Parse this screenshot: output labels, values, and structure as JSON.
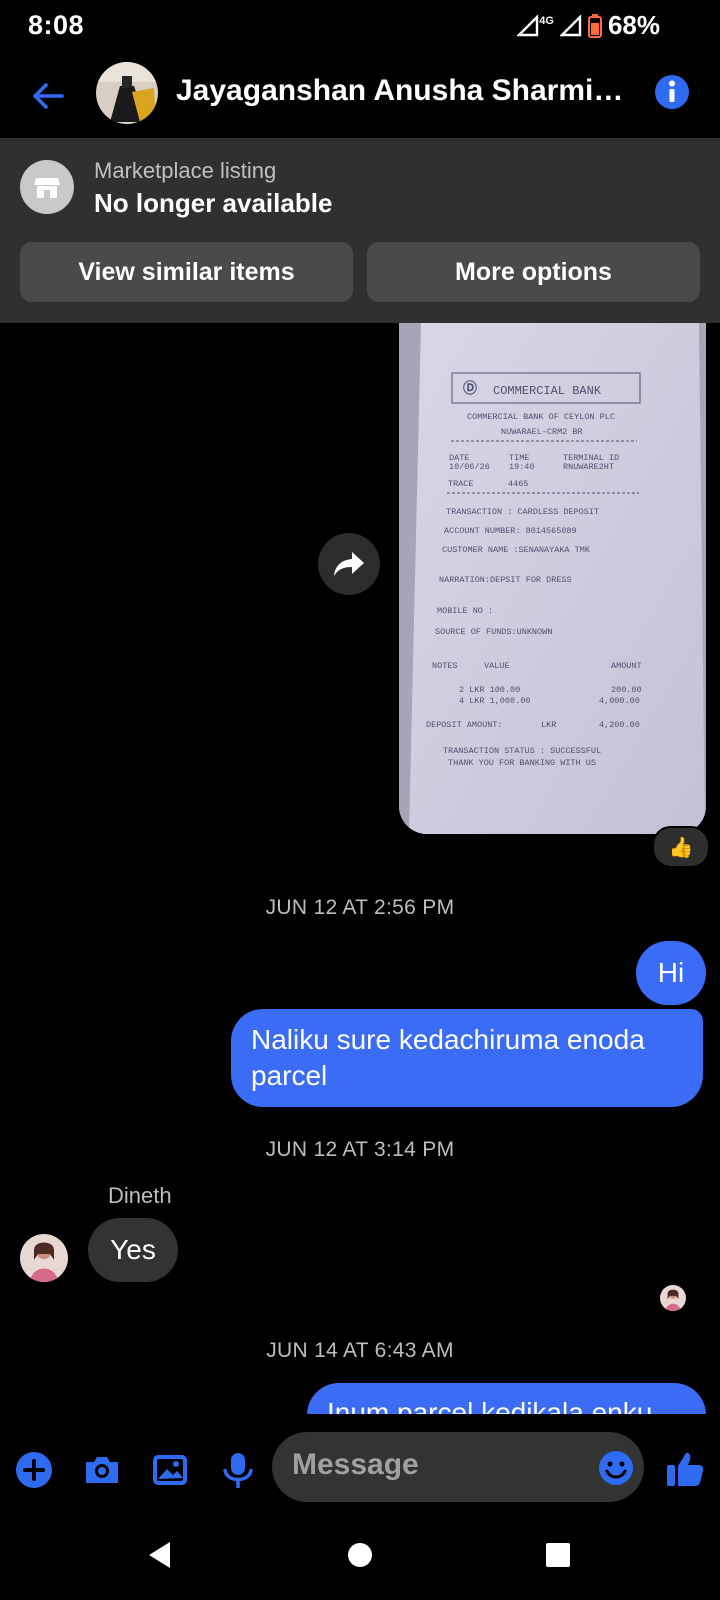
{
  "status_bar": {
    "time": "8:08",
    "network": "4G",
    "battery": "68%"
  },
  "header": {
    "contact_name": "Jayaganshan Anusha Sharmila…",
    "back_icon": "arrow-left-icon",
    "info_icon": "info-icon"
  },
  "marketplace": {
    "label": "Marketplace listing",
    "status": "No longer available",
    "btn_similar": "View similar items",
    "btn_more": "More options",
    "icon": "storefront-icon"
  },
  "receipt": {
    "bank": "COMMERCIAL BANK",
    "bank_full": "COMMERCIAL BANK OF CEYLON PLC",
    "branch": "NUWARAEL-CRM2 BR",
    "date_label": "DATE",
    "date": "10/06/26",
    "time_label": "TIME",
    "time": "19:40",
    "terminal_label": "TERMINAL ID",
    "terminal": "RNUWARE2HT",
    "trace_label": "TRACE",
    "trace": "4465",
    "transaction": "TRANSACTION   : CARDLESS DEPOSIT",
    "account": "ACCOUNT NUMBER: 8014565089",
    "customer": "CUSTOMER NAME :SENANAYAKA TMK",
    "narration": "NARRATION:DEPSIT FOR DRESS",
    "mobile": "MOBILE NO :",
    "source": "SOURCE OF FUNDS:UNKNOWN",
    "notes_header": "NOTES",
    "value_header": "VALUE",
    "amount_header": "AMOUNT",
    "row1": "2   LKR   100.00",
    "row1_amt": "200.00",
    "row2": "4   LKR 1,000.00",
    "row2_amt": "4,000.00",
    "deposit_label": "DEPOSIT AMOUNT:",
    "deposit_cur": "LKR",
    "deposit_amt": "4,200.00",
    "status_line": "TRANSACTION STATUS : SUCCESSFUL",
    "thanks": "THANK YOU FOR BANKING WITH US"
  },
  "reaction": "👍",
  "messages": {
    "ts1": "JUN 12 AT 2:56 PM",
    "hi": "Hi",
    "naliku": "Naliku sure kedachiruma enoda parcel",
    "ts2": "JUN 12 AT 3:14 PM",
    "sender": "Dineth",
    "yes": "Yes",
    "ts3": "JUN 14 AT 6:43 AM",
    "partial": "Inum parcel kedikala enku"
  },
  "composer": {
    "placeholder": "Message",
    "icons": [
      "plus-icon",
      "camera-icon",
      "gallery-icon",
      "microphone-icon",
      "emoji-icon",
      "thumbs-up-icon"
    ]
  },
  "colors": {
    "accent": "#3b6cf5",
    "icon_blue": "#2f6bf1",
    "background": "#000000",
    "panel": "#303030"
  }
}
